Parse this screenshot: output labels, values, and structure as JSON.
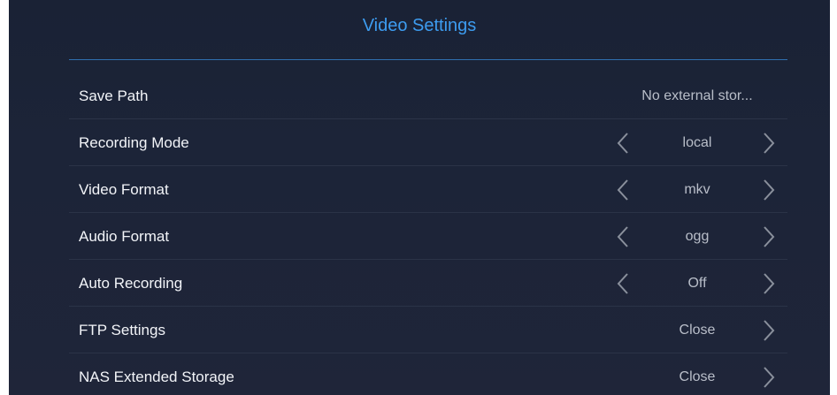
{
  "header": {
    "title": "Video Settings"
  },
  "rows": [
    {
      "label": "Save Path",
      "value": "No external stor..."
    },
    {
      "label": "Recording Mode",
      "value": "local"
    },
    {
      "label": "Video Format",
      "value": "mkv"
    },
    {
      "label": "Audio Format",
      "value": "ogg"
    },
    {
      "label": "Auto Recording",
      "value": "Off"
    },
    {
      "label": "FTP Settings",
      "value": "Close"
    },
    {
      "label": "NAS Extended Storage",
      "value": "Close"
    }
  ],
  "icons": {
    "prev": "chevron-left-icon",
    "next": "chevron-right-icon"
  },
  "colors": {
    "background": "#1c2438",
    "accent": "#3d9cf0",
    "label": "#f2f4f8",
    "value": "#b9bec9",
    "arrow": "#8a909c"
  }
}
